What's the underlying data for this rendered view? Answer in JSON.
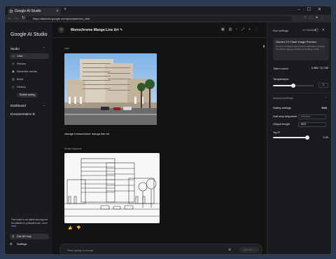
{
  "browser": {
    "tab_title": "Google AI Studio",
    "url": "https://aistudio.google.com/prompts/new_chat"
  },
  "sidebar": {
    "logo": "Google AI Studio",
    "studio_label": "Studio",
    "items": [
      {
        "label": "Chat",
        "icon": "chat-icon"
      },
      {
        "label": "Stream",
        "icon": "stream-icon"
      },
      {
        "label": "Generate media",
        "icon": "media-icon"
      },
      {
        "label": "Build",
        "icon": "build-icon"
      },
      {
        "label": "History",
        "icon": "history-icon"
      }
    ],
    "enable_saving": "Enable saving",
    "dashboard": "Dashboard",
    "documentation": "Documentation",
    "notice": "This model is not stable and may not be suitable for production use.",
    "learn_more": "Learn more",
    "get_api_key": "Get API key",
    "settings": "Settings"
  },
  "main": {
    "title": "Monochrome Manga Line Art",
    "user_label": "User",
    "user_prompt": "change monochrome manga line art",
    "model_label": "Model response",
    "input_placeholder": "Start typing a prompt",
    "run_label": "Run  Ctrl ↵"
  },
  "run_settings": {
    "header": "Run settings",
    "get_code": "Get code",
    "model_name": "Gemini 2.0 Flash Image Preview",
    "model_desc": "Gemini 2.5 Flash Image preview (aka Nano banana) Top-rated image generation and editing model",
    "token_count_label": "Token count",
    "token_count_value": "2,588 / 32,768",
    "temperature_label": "Temperature",
    "temperature_value": "1",
    "temperature_fraction": 0.5,
    "advanced_label": "Advanced settings",
    "safety_label": "Safety settings",
    "safety_edit": "Edit",
    "stop_label": "Add stop sequence",
    "stop_placeholder": "Add stop...",
    "output_label": "Output length",
    "output_value": "8192",
    "topp_label": "Top P",
    "topp_value": "0.95",
    "topp_fraction": 0.95
  }
}
